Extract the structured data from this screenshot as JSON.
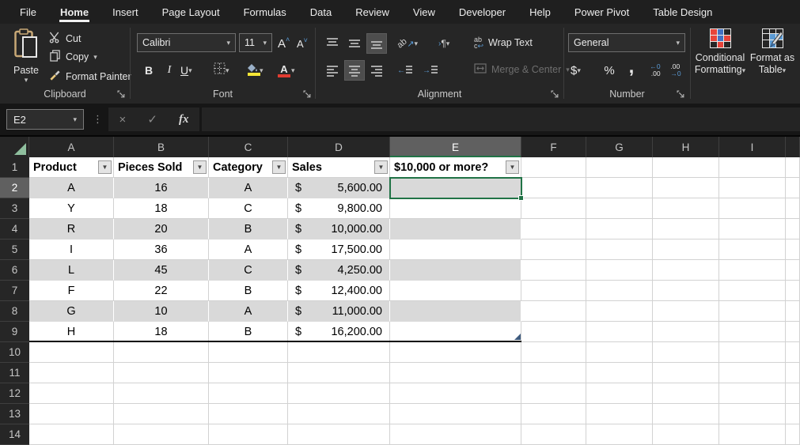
{
  "menu": {
    "items": [
      "File",
      "Home",
      "Insert",
      "Page Layout",
      "Formulas",
      "Data",
      "Review",
      "View",
      "Developer",
      "Help",
      "Power Pivot",
      "Table Design"
    ],
    "active": "Home"
  },
  "ribbon": {
    "clipboard": {
      "group_label": "Clipboard",
      "paste_label": "Paste",
      "cut_label": "Cut",
      "copy_label": "Copy",
      "format_painter_label": "Format Painter"
    },
    "font": {
      "group_label": "Font",
      "font_name": "Calibri",
      "font_size": "11",
      "bold_label": "B",
      "italic_label": "I",
      "underline_label": "U"
    },
    "alignment": {
      "group_label": "Alignment",
      "wrap_text_label": "Wrap Text",
      "merge_center_label": "Merge & Center",
      "wrap_icon_text": "ab",
      "orientation_icon_text": "ab",
      "pilcrow": "¶"
    },
    "number": {
      "group_label": "Number",
      "number_format": "General",
      "currency_label": "$",
      "percent_label": "%",
      "comma_label": ",",
      "increase_decimal_top": "←0",
      "increase_decimal_bottom": ".00",
      "decrease_decimal_top": ".00",
      "decrease_decimal_bottom": "→0"
    },
    "styles": {
      "conditional_formatting_line1": "Conditional",
      "conditional_formatting_line2": "Formatting",
      "format_as_table_line1": "Format as",
      "format_as_table_line2": "Table"
    }
  },
  "formula_bar": {
    "name_box_value": "E2",
    "formula_value": "",
    "fx_label": "fx",
    "cancel_icon": "×",
    "enter_icon": "✓",
    "dots_icon": "⋮"
  },
  "icons": {
    "chevron_down": "▾",
    "filter_arrow": "▼"
  },
  "sheet": {
    "visible_columns": [
      "A",
      "B",
      "C",
      "D",
      "E",
      "F",
      "G",
      "H",
      "I"
    ],
    "visible_rows": [
      "1",
      "2",
      "3",
      "4",
      "5",
      "6",
      "7",
      "8",
      "9",
      "10",
      "11",
      "12",
      "13",
      "14"
    ],
    "selected_cell": "E2",
    "selected_column": "E",
    "selected_row": "2",
    "table": {
      "currency_symbol": "$",
      "headers": [
        "Product",
        "Pieces Sold",
        "Category",
        "Sales",
        "$10,000 or more?"
      ],
      "rows": [
        {
          "product": "A",
          "pieces_sold": "16",
          "category": "A",
          "sales": "5,600.00",
          "answer": ""
        },
        {
          "product": "Y",
          "pieces_sold": "18",
          "category": "C",
          "sales": "9,800.00",
          "answer": ""
        },
        {
          "product": "R",
          "pieces_sold": "20",
          "category": "B",
          "sales": "10,000.00",
          "answer": ""
        },
        {
          "product": "I",
          "pieces_sold": "36",
          "category": "A",
          "sales": "17,500.00",
          "answer": ""
        },
        {
          "product": "L",
          "pieces_sold": "45",
          "category": "C",
          "sales": "4,250.00",
          "answer": ""
        },
        {
          "product": "F",
          "pieces_sold": "22",
          "category": "B",
          "sales": "12,400.00",
          "answer": ""
        },
        {
          "product": "G",
          "pieces_sold": "10",
          "category": "A",
          "sales": "11,000.00",
          "answer": ""
        },
        {
          "product": "H",
          "pieces_sold": "18",
          "category": "B",
          "sales": "16,200.00",
          "answer": ""
        }
      ]
    }
  },
  "colors": {
    "accent_green": "#217346",
    "select_all_triangle": "#8fbf9e",
    "banded_row": "#d9d9d9",
    "fill_color_swatch": "#f5e636",
    "font_color_swatch": "#e03c31",
    "cf_icon_red": "#e8443a",
    "cf_icon_blue": "#4472c4",
    "table_icon_blue": "#5b9bd5",
    "resize_handle": "#3e5b7e"
  }
}
